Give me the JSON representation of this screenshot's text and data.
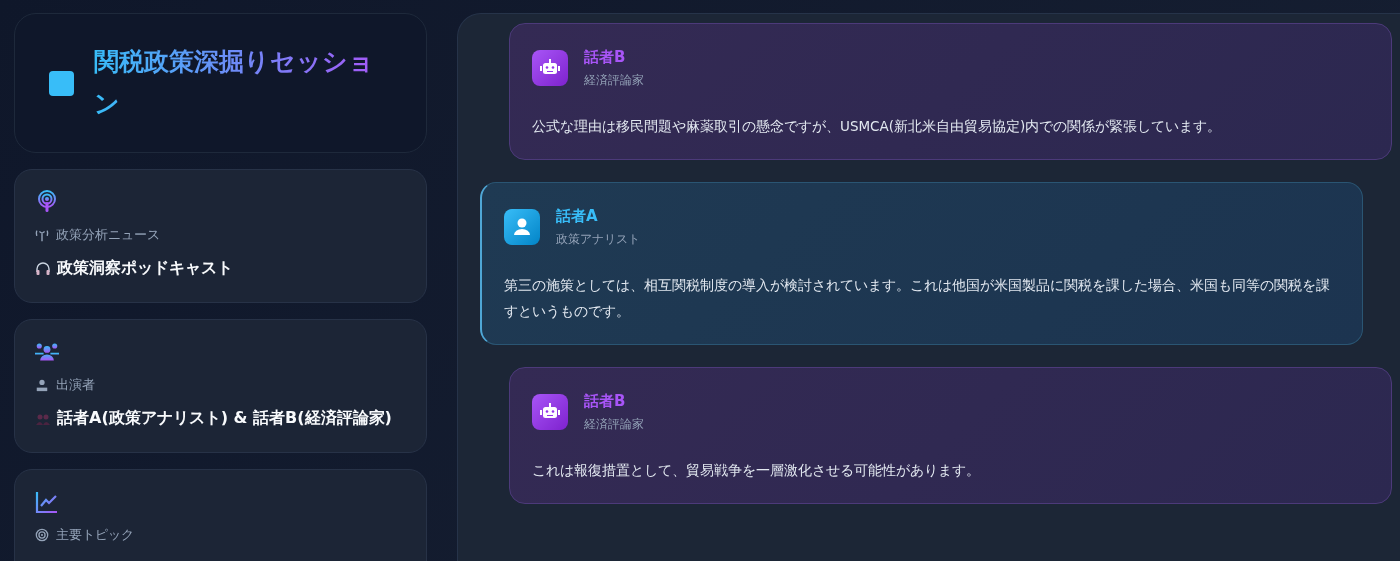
{
  "header": {
    "title": "関税政策深掘りセッション"
  },
  "info_cards": [
    {
      "kind": "podcast",
      "label": {
        "kind": "antenna",
        "text": "政策分析ニュース"
      },
      "value": {
        "kind": "headphones",
        "text": "政策洞察ポッドキャスト"
      }
    },
    {
      "kind": "people",
      "label": {
        "kind": "person",
        "text": "出演者"
      },
      "value": {
        "kind": "pair",
        "text": "話者A(政策アナリスト) & 話者B(経済評論家)"
      }
    },
    {
      "kind": "chart",
      "label": {
        "kind": "target",
        "text": "主要トピック"
      }
    }
  ],
  "messages": [
    {
      "kind": "b",
      "name": "話者B",
      "role": "経済評論家",
      "text": "公式な理由は移民問題や麻薬取引の懸念ですが、USMCA(新北米自由貿易協定)内での関係が緊張しています。"
    },
    {
      "kind": "a",
      "name": "話者A",
      "role": "政策アナリスト",
      "text": "第三の施策としては、相互関税制度の導入が検討されています。これは他国が米国製品に関税を課した場合、米国も同等の関税を課すというものです。"
    },
    {
      "kind": "b",
      "name": "話者B",
      "role": "経済評論家",
      "text": "これは報復措置として、貿易戦争を一層激化させる可能性があります。"
    }
  ]
}
